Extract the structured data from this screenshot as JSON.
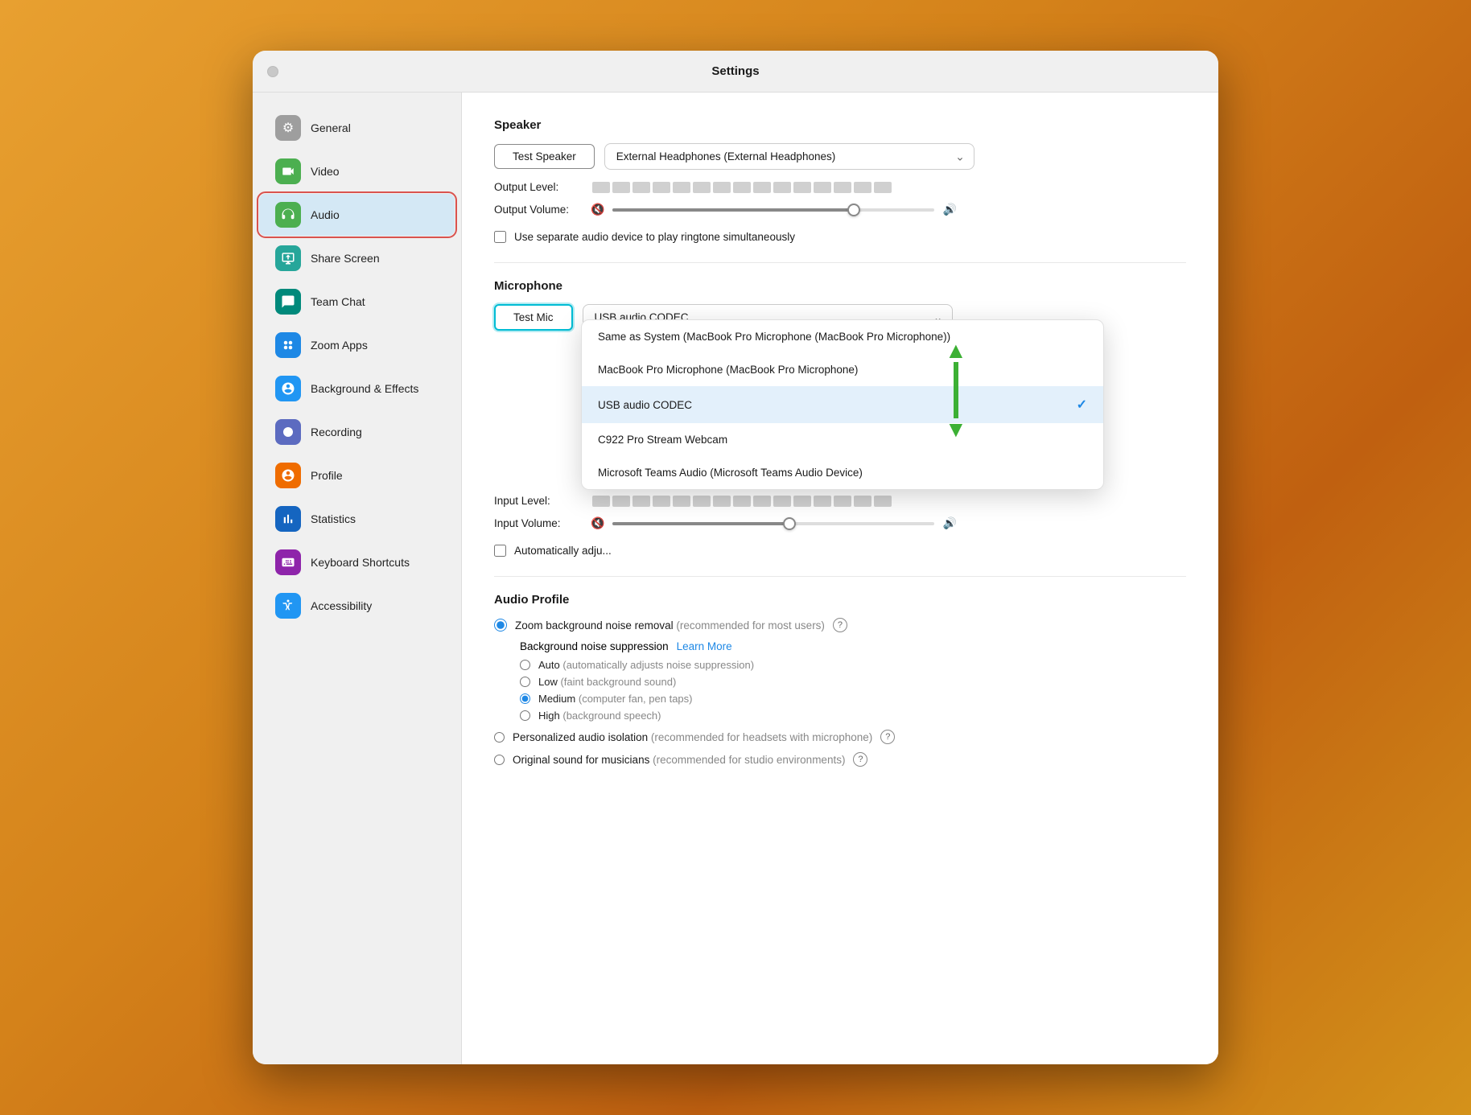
{
  "window": {
    "title": "Settings"
  },
  "sidebar": {
    "items": [
      {
        "id": "general",
        "label": "General",
        "icon": "⚙",
        "iconClass": "icon-gray"
      },
      {
        "id": "video",
        "label": "Video",
        "icon": "📹",
        "iconClass": "icon-green"
      },
      {
        "id": "audio",
        "label": "Audio",
        "icon": "🎧",
        "iconClass": "icon-green-headphone",
        "active": true
      },
      {
        "id": "share-screen",
        "label": "Share Screen",
        "icon": "↑",
        "iconClass": "icon-teal"
      },
      {
        "id": "team-chat",
        "label": "Team Chat",
        "icon": "💬",
        "iconClass": "icon-teal2"
      },
      {
        "id": "zoom-apps",
        "label": "Zoom Apps",
        "icon": "⊞",
        "iconClass": "icon-blue"
      },
      {
        "id": "background-effects",
        "label": "Background & Effects",
        "icon": "👤",
        "iconClass": "icon-blue2"
      },
      {
        "id": "recording",
        "label": "Recording",
        "icon": "⏺",
        "iconClass": "icon-indigo"
      },
      {
        "id": "profile",
        "label": "Profile",
        "icon": "👤",
        "iconClass": "icon-orange"
      },
      {
        "id": "statistics",
        "label": "Statistics",
        "icon": "📊",
        "iconClass": "icon-blue3"
      },
      {
        "id": "keyboard-shortcuts",
        "label": "Keyboard Shortcuts",
        "icon": "⌨",
        "iconClass": "icon-purple"
      },
      {
        "id": "accessibility",
        "label": "Accessibility",
        "icon": "♿",
        "iconClass": "icon-blue2"
      }
    ]
  },
  "main": {
    "speaker": {
      "section_title": "Speaker",
      "test_button": "Test Speaker",
      "device": "External Headphones (External Headphones)",
      "output_level_label": "Output Level:",
      "output_volume_label": "Output Volume:",
      "volume_percent": 75,
      "checkbox_label": "Use separate audio device to play ringtone simultaneously"
    },
    "microphone": {
      "section_title": "Microphone",
      "test_button": "Test Mic",
      "device": "USB audio CODEC",
      "input_level_label": "Input Level:",
      "input_volume_label": "Input Volume:",
      "auto_adjust_label": "Automatically adju...",
      "dropdown": {
        "options": [
          {
            "label": "Same as System (MacBook Pro Microphone (MacBook Pro Microphone))",
            "selected": false
          },
          {
            "label": "MacBook Pro Microphone (MacBook Pro Microphone)",
            "selected": false
          },
          {
            "label": "USB audio CODEC",
            "selected": true
          },
          {
            "label": "C922 Pro Stream Webcam",
            "selected": false
          },
          {
            "label": "Microsoft Teams Audio (Microsoft Teams Audio Device)",
            "selected": false
          }
        ]
      }
    },
    "audio_profile": {
      "section_title": "Audio Profile",
      "zoom_bg_noise_label": "Zoom background noise removal",
      "zoom_bg_noise_sub": "(recommended for most users)",
      "bg_noise_suppression_label": "Background noise suppression",
      "learn_more": "Learn More",
      "noise_options": [
        {
          "label": "Auto",
          "sub": "(automatically adjusts noise suppression)",
          "selected": false
        },
        {
          "label": "Low",
          "sub": "(faint background sound)",
          "selected": false
        },
        {
          "label": "Medium",
          "sub": "(computer fan, pen taps)",
          "selected": true
        },
        {
          "label": "High",
          "sub": "(background speech)",
          "selected": false
        }
      ],
      "personalized_label": "Personalized audio isolation",
      "personalized_sub": "(recommended for headsets with microphone)",
      "original_sound_label": "Original sound for musicians",
      "original_sound_sub": "(recommended for studio environments)"
    }
  }
}
